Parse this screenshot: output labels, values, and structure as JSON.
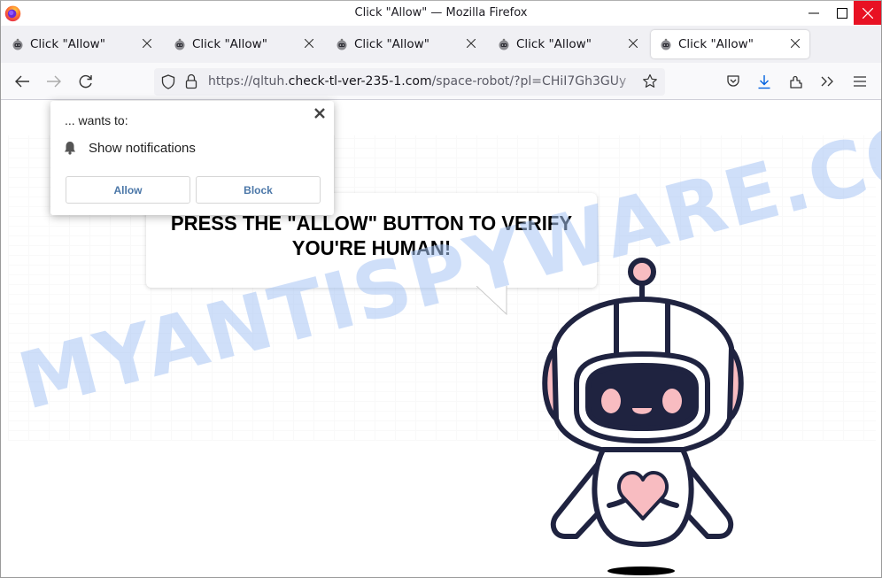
{
  "window": {
    "title": "Click \"Allow\" — Mozilla Firefox",
    "controls": {
      "minimize": "minimize",
      "maximize": "maximize",
      "close": "close"
    },
    "close_color": "#e81123"
  },
  "tabs": [
    {
      "label": "Click \"Allow\"",
      "active": false
    },
    {
      "label": "Click \"Allow\"",
      "active": false
    },
    {
      "label": "Click \"Allow\"",
      "active": false
    },
    {
      "label": "Click \"Allow\"",
      "active": false
    },
    {
      "label": "Click \"Allow\"",
      "active": true
    }
  ],
  "navbar": {
    "url_prefix": "https://qltuh.",
    "url_domain": "check-tl-ver-235-1.com",
    "url_path": "/space-robot/?pl=CHiI7Gh3GUy",
    "icons": [
      "back-icon",
      "forward-icon",
      "reload-icon",
      "shield-icon",
      "lock-icon",
      "bookmark-star-icon",
      "pocket-icon",
      "download-icon",
      "extensions-icon",
      "overflow-icon",
      "menu-icon"
    ],
    "download_color": "#0060df"
  },
  "permission_popup": {
    "wants_to": "... wants to:",
    "permission": "Show notifications",
    "allow_label": "Allow",
    "block_label": "Block",
    "button_text_color": "#4b77a8"
  },
  "page": {
    "message": "PRESS THE \"ALLOW\" BUTTON TO VERIFY YOU'RE HUMAN!",
    "watermark": "MYANTISPYWARE.COM",
    "robot_colors": {
      "outline": "#1f2340",
      "accent": "#f8bcc1",
      "visor": "#1f2340"
    }
  }
}
